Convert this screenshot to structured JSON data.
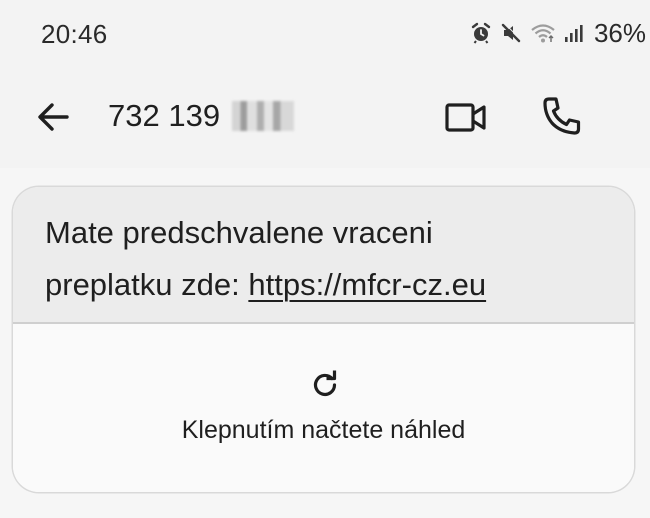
{
  "status_bar": {
    "time": "20:46",
    "icons": [
      "alarm-icon",
      "mute-icon",
      "wifi-icon",
      "signal-icon"
    ],
    "battery": "36%"
  },
  "app_bar": {
    "back_icon": "arrow-back-icon",
    "contact_number": "732 139",
    "video_icon": "videocam-icon",
    "call_icon": "phone-icon"
  },
  "message": {
    "text_line1": "Mate predschvalene vraceni",
    "text_prefix": "preplatku zde: ",
    "link": "https://mfcr-cz.eu",
    "preview": {
      "icon": "refresh-icon",
      "label": "Klepnutím načtete náhled"
    }
  },
  "colors": {
    "background": "#f6f6f6",
    "bar_background": "#f3f3f3",
    "bubble_text_bg": "#ececec",
    "text": "#1f1f1f"
  }
}
